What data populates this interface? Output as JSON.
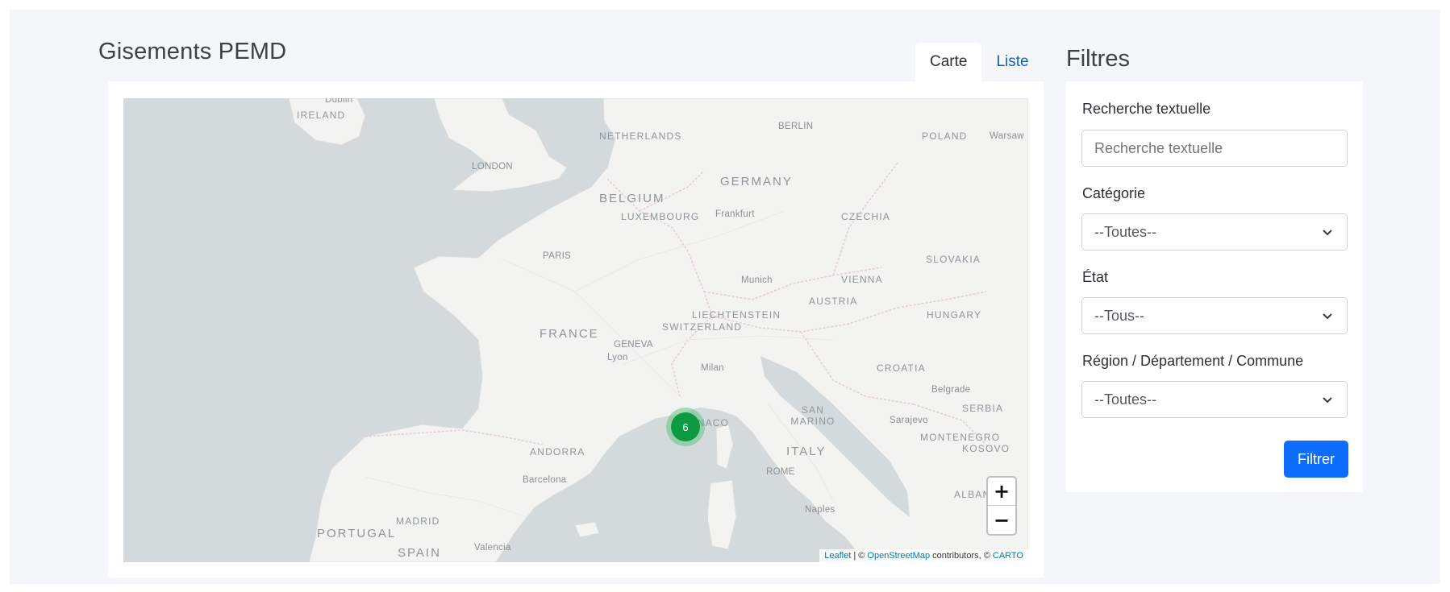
{
  "page": {
    "title": "Gisements PEMD"
  },
  "tabs": [
    {
      "label": "Carte",
      "active": true
    },
    {
      "label": "Liste",
      "active": false
    }
  ],
  "map": {
    "labels": {
      "dublin": "Dublin",
      "ireland": "IRELAND",
      "netherlands": "NETHERLANDS",
      "berlin": "BERLIN",
      "poland": "POLAND",
      "warsaw": "Warsaw",
      "london": "LONDON",
      "germany": "GERMANY",
      "belgium": "BELGIUM",
      "luxembourg": "LUXEMBOURG",
      "frankfurt": "Frankfurt",
      "czechia": "CZECHIA",
      "paris": "PARIS",
      "slovakia": "SLOVAKIA",
      "munich": "Munich",
      "vienna": "VIENNA",
      "austria": "AUSTRIA",
      "liechtenstein": "LIECHTENSTEIN",
      "switzerland": "SWITZERLAND",
      "hungary": "HUNGARY",
      "france": "FRANCE",
      "geneva": "GENEVA",
      "lyon": "Lyon",
      "milan": "Milan",
      "croatia": "CROATIA",
      "belgrade": "Belgrade",
      "serbia": "SERBIA",
      "monaco": "MONACO",
      "san_marino": "SAN MARINO",
      "sarajevo": "Sarajevo",
      "montenegro": "MONTENEGRO",
      "kosovo": "KOSOVO",
      "andorra": "ANDORRA",
      "italy": "ITALY",
      "rome": "ROME",
      "barcelona": "Barcelona",
      "naples": "Naples",
      "albania": "ALBANIA",
      "portugal": "PORTUGAL",
      "madrid": "MADRID",
      "spain": "SPAIN",
      "valencia": "Valencia"
    },
    "cluster_count": "6",
    "zoom_in": "+",
    "zoom_out": "−",
    "attribution": {
      "leaflet": "Leaflet",
      "sep": " | © ",
      "osm": "OpenStreetMap",
      "contrib": " contributors, © ",
      "carto": "CARTO"
    }
  },
  "filters": {
    "title": "Filtres",
    "text_search": {
      "label": "Recherche textuelle",
      "placeholder": "Recherche textuelle"
    },
    "category": {
      "label": "Catégorie",
      "value": "--Toutes--"
    },
    "state": {
      "label": "État",
      "value": "--Tous--"
    },
    "region": {
      "label": "Région / Département / Commune",
      "value": "--Toutes--"
    },
    "submit_label": "Filtrer"
  },
  "colors": {
    "accent": "#0d6efd",
    "cluster": "#0c9a43",
    "land": "#f3f3f1",
    "sea": "#d4dadc"
  }
}
